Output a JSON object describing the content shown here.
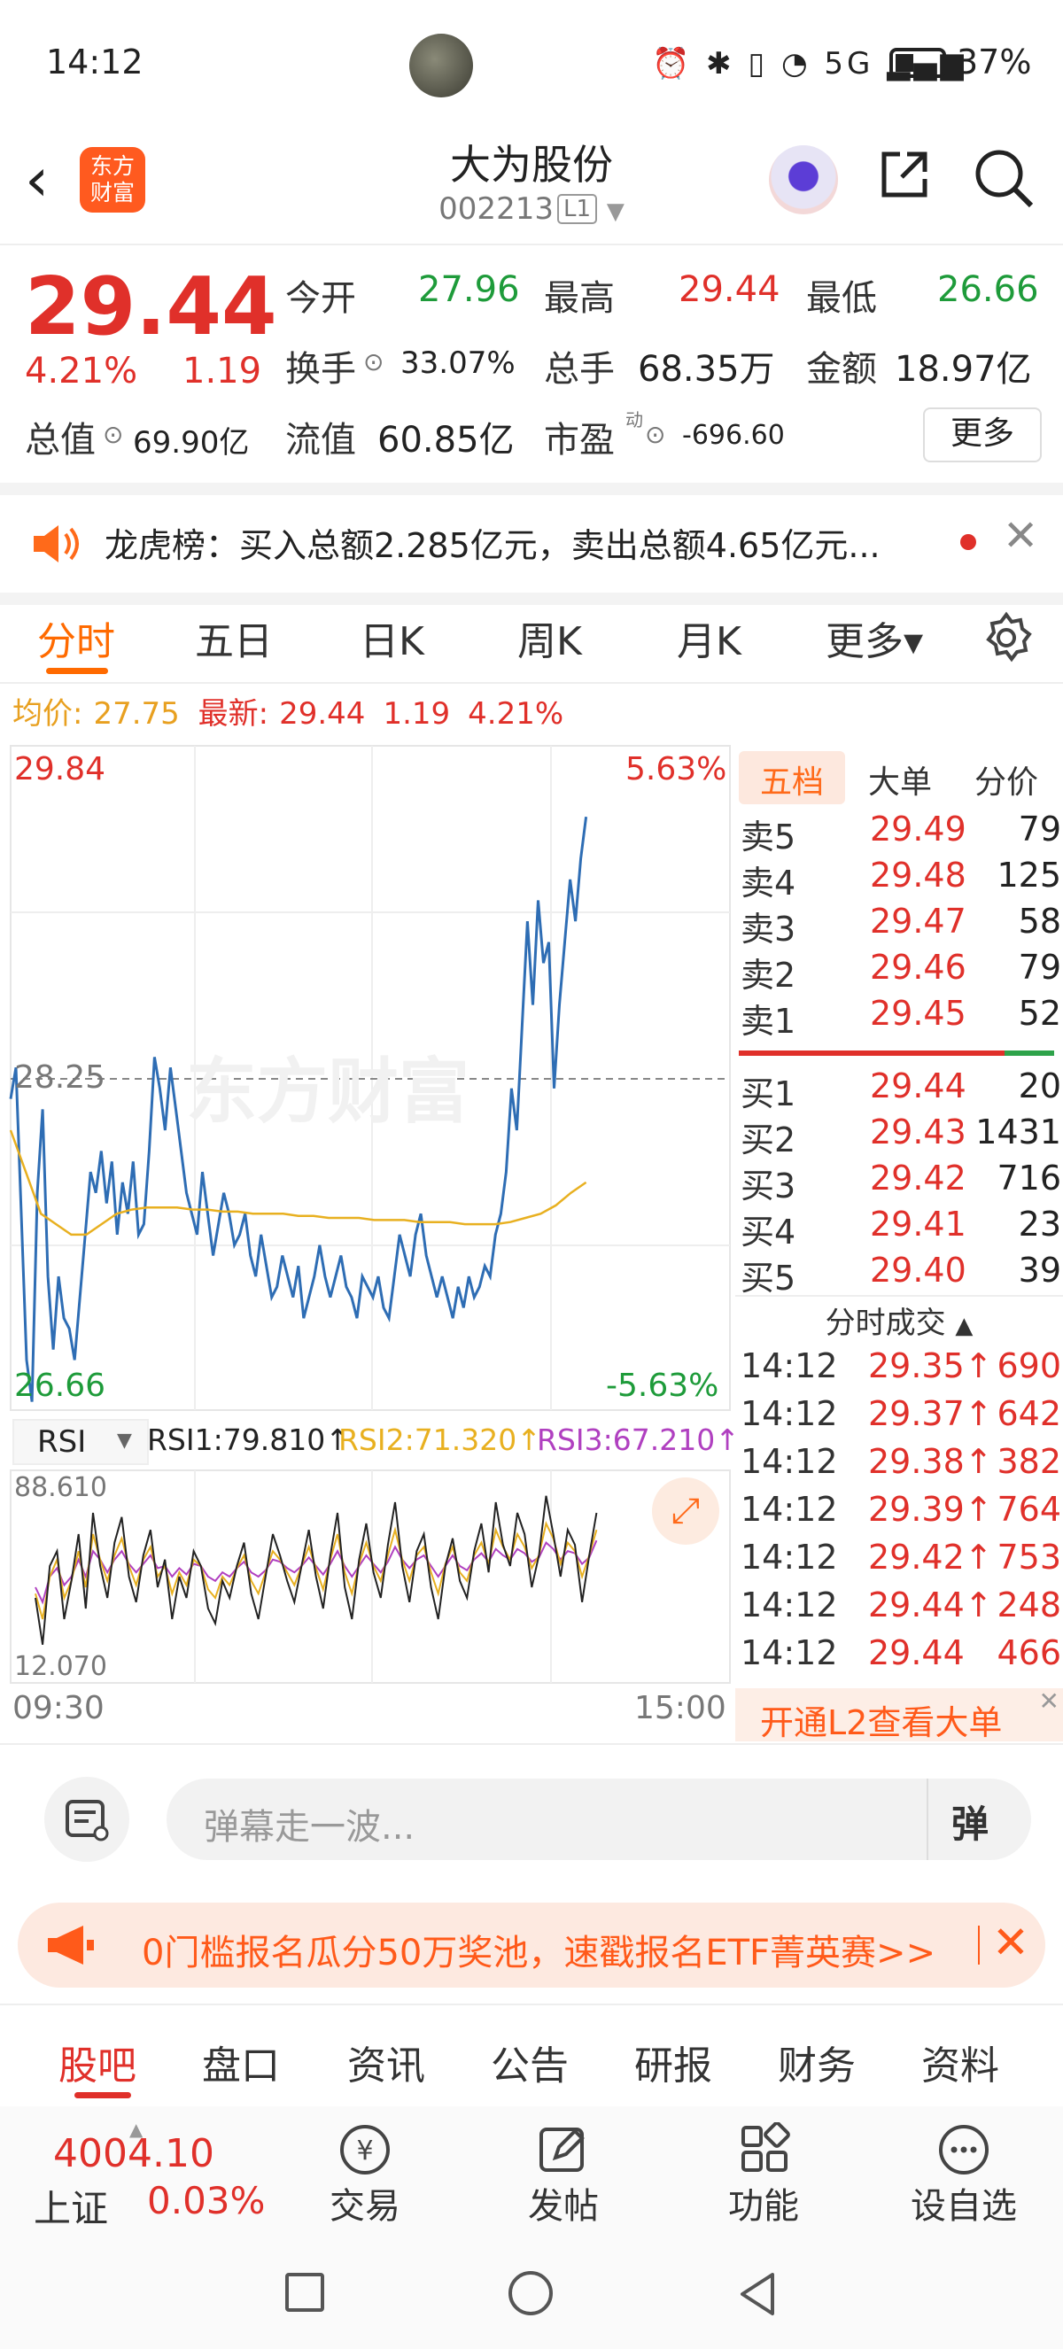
{
  "status_bar": {
    "time": "14:12",
    "icons": "⏰ ✱ ▯ ◔ 5G ▂▄▆",
    "battery_pct": "37%"
  },
  "header": {
    "logo_line1": "东方",
    "logo_line2": "财富",
    "stock_name": "大为股份",
    "stock_code": "002213",
    "level_badge": "L1"
  },
  "quote": {
    "price": "29.44",
    "change_pct": "4.21%",
    "change": "1.19",
    "open_label": "今开",
    "open": "27.96",
    "high_label": "最高",
    "high": "29.44",
    "low_label": "最低",
    "low": "26.66",
    "turnover_label": "换手",
    "turnover": "33.07%",
    "volume_label": "总手",
    "volume": "68.35万",
    "amount_label": "金额",
    "amount": "18.97亿",
    "mktcap_label": "总值",
    "mktcap": "69.90亿",
    "float_label": "流值",
    "float_cap": "60.85亿",
    "pe_label": "市盈",
    "pe_sup": "动",
    "pe": "-696.60",
    "more_button": "更多"
  },
  "notice": {
    "text": "龙虎榜：买入总额2.285亿元，卖出总额4.65亿元..."
  },
  "chart_tabs": [
    "分时",
    "五日",
    "日K",
    "周K",
    "月K",
    "更多▾"
  ],
  "info_line": {
    "avg_label": "均价:",
    "avg": "27.75",
    "latest_label": "最新:",
    "latest": "29.44",
    "chg": "1.19",
    "pct": "4.21%"
  },
  "chart_data": {
    "type": "line",
    "title": "",
    "price_axis": {
      "max": "29.84",
      "mid": "28.25",
      "min": "26.66",
      "max_pct": "5.63%",
      "min_pct": "-5.63%"
    },
    "ylim": [
      26.66,
      29.84
    ],
    "prev_close": 28.25,
    "x_start": "09:30",
    "x_end": "15:00",
    "series": [
      {
        "name": "price",
        "color": "#2e6db4",
        "values": [
          28.15,
          28.3,
          27.6,
          26.9,
          26.7,
          27.7,
          28.1,
          27.3,
          26.95,
          27.3,
          27.1,
          27.05,
          26.9,
          27.2,
          27.5,
          27.8,
          27.7,
          27.9,
          27.65,
          27.85,
          27.5,
          27.75,
          27.6,
          27.85,
          27.5,
          27.55,
          27.9,
          28.35,
          28.2,
          28.0,
          28.3,
          28.1,
          27.9,
          27.7,
          27.6,
          27.5,
          27.8,
          27.6,
          27.4,
          27.55,
          27.7,
          27.6,
          27.45,
          27.5,
          27.6,
          27.4,
          27.3,
          27.5,
          27.35,
          27.2,
          27.25,
          27.4,
          27.3,
          27.2,
          27.35,
          27.1,
          27.2,
          27.3,
          27.45,
          27.3,
          27.2,
          27.3,
          27.4,
          27.25,
          27.2,
          27.1,
          27.3,
          27.25,
          27.2,
          27.3,
          27.15,
          27.1,
          27.3,
          27.5,
          27.4,
          27.3,
          27.5,
          27.6,
          27.4,
          27.3,
          27.2,
          27.3,
          27.2,
          27.1,
          27.25,
          27.15,
          27.3,
          27.2,
          27.25,
          27.35,
          27.3,
          27.5,
          27.6,
          27.8,
          28.2,
          28.0,
          28.5,
          29.0,
          28.6,
          29.1,
          28.8,
          28.9,
          28.2,
          28.6,
          28.9,
          29.2,
          29.0,
          29.3,
          29.5
        ]
      },
      {
        "name": "avg",
        "color": "#e8b020",
        "values": [
          28.0,
          27.8,
          27.6,
          27.55,
          27.5,
          27.5,
          27.55,
          27.6,
          27.62,
          27.63,
          27.63,
          27.63,
          27.62,
          27.62,
          27.61,
          27.61,
          27.6,
          27.6,
          27.6,
          27.59,
          27.59,
          27.58,
          27.58,
          27.58,
          27.57,
          27.57,
          27.57,
          27.56,
          27.56,
          27.56,
          27.55,
          27.55,
          27.55,
          27.56,
          27.58,
          27.6,
          27.64,
          27.7,
          27.75
        ]
      }
    ]
  },
  "order_book": {
    "tabs": [
      "五档",
      "大单",
      "分价"
    ],
    "asks": [
      [
        "卖5",
        "29.49",
        "79"
      ],
      [
        "卖4",
        "29.48",
        "125"
      ],
      [
        "卖3",
        "29.47",
        "58"
      ],
      [
        "卖2",
        "29.46",
        "79"
      ],
      [
        "卖1",
        "29.45",
        "52"
      ]
    ],
    "bids": [
      [
        "买1",
        "29.44",
        "20"
      ],
      [
        "买2",
        "29.43",
        "1431"
      ],
      [
        "买3",
        "29.42",
        "716"
      ],
      [
        "买4",
        "29.41",
        "23"
      ],
      [
        "买5",
        "29.40",
        "39"
      ]
    ],
    "ticks_title": "分时成交",
    "ticks": [
      [
        "14:12",
        "29.35↑",
        "690"
      ],
      [
        "14:12",
        "29.37↑",
        "642"
      ],
      [
        "14:12",
        "29.38↑",
        "382"
      ],
      [
        "14:12",
        "29.39↑",
        "764"
      ],
      [
        "14:12",
        "29.42↑",
        "753"
      ],
      [
        "14:12",
        "29.44↑",
        "248"
      ],
      [
        "14:12",
        "29.44",
        "466"
      ]
    ],
    "l2_button": "开通L2查看大单"
  },
  "rsi": {
    "selector": "RSI",
    "rsi1": "RSI1:79.810↑",
    "rsi2": "RSI2:71.320↑",
    "rsi3": "RSI3:67.210↑",
    "top": "88.610",
    "bottom": "12.070",
    "colors": {
      "rsi1": "#222222",
      "rsi2": "#e8b020",
      "rsi3": "#b040c0"
    },
    "rsi1_values": [
      40,
      18,
      55,
      62,
      30,
      48,
      70,
      35,
      80,
      55,
      40,
      66,
      78,
      50,
      38,
      60,
      72,
      45,
      58,
      30,
      50,
      40,
      62,
      55,
      35,
      28,
      48,
      40,
      55,
      66,
      42,
      30,
      50,
      70,
      60,
      48,
      38,
      55,
      72,
      50,
      35,
      60,
      80,
      45,
      30,
      58,
      75,
      52,
      40,
      65,
      85,
      55,
      38,
      62,
      70,
      45,
      30,
      55,
      68,
      48,
      40,
      62,
      75,
      52,
      85,
      65,
      55,
      80,
      70,
      45,
      60,
      88,
      70,
      50,
      72,
      65,
      38,
      60,
      80
    ],
    "rsi2_values": [
      42,
      30,
      50,
      58,
      40,
      48,
      62,
      45,
      70,
      58,
      48,
      60,
      68,
      55,
      46,
      58,
      64,
      50,
      55,
      42,
      52,
      46,
      58,
      55,
      44,
      40,
      50,
      46,
      54,
      60,
      48,
      42,
      52,
      62,
      58,
      52,
      46,
      55,
      64,
      54,
      44,
      58,
      70,
      52,
      42,
      56,
      66,
      55,
      48,
      60,
      72,
      58,
      48,
      60,
      64,
      52,
      42,
      56,
      64,
      52,
      48,
      60,
      66,
      56,
      72,
      64,
      58,
      70,
      64,
      54,
      60,
      75,
      68,
      56,
      66,
      62,
      50,
      60,
      72
    ],
    "rsi3_values": [
      45,
      38,
      50,
      54,
      46,
      50,
      58,
      50,
      62,
      58,
      52,
      58,
      62,
      56,
      52,
      56,
      60,
      54,
      55,
      50,
      54,
      51,
      56,
      55,
      50,
      48,
      52,
      50,
      54,
      57,
      52,
      50,
      53,
      58,
      57,
      54,
      52,
      55,
      59,
      55,
      51,
      56,
      62,
      55,
      50,
      55,
      60,
      56,
      52,
      57,
      64,
      58,
      54,
      58,
      60,
      55,
      50,
      55,
      60,
      55,
      53,
      58,
      61,
      57,
      63,
      60,
      58,
      63,
      61,
      57,
      59,
      66,
      63,
      58,
      62,
      61,
      56,
      59,
      67
    ]
  },
  "comment": {
    "placeholder": "弹幕走一波..."
  },
  "banner": {
    "text": "0门槛报名瓜分50万奖池，速戳报名ETF菁英赛>>"
  },
  "bottom_tabs": [
    "股吧",
    "盘口",
    "资讯",
    "公告",
    "研报",
    "财务",
    "资料"
  ],
  "index": {
    "value": "4004.10",
    "name": "上证",
    "pct": "0.03%"
  },
  "toolbar": [
    "交易",
    "发帖",
    "功能",
    "设自选"
  ]
}
